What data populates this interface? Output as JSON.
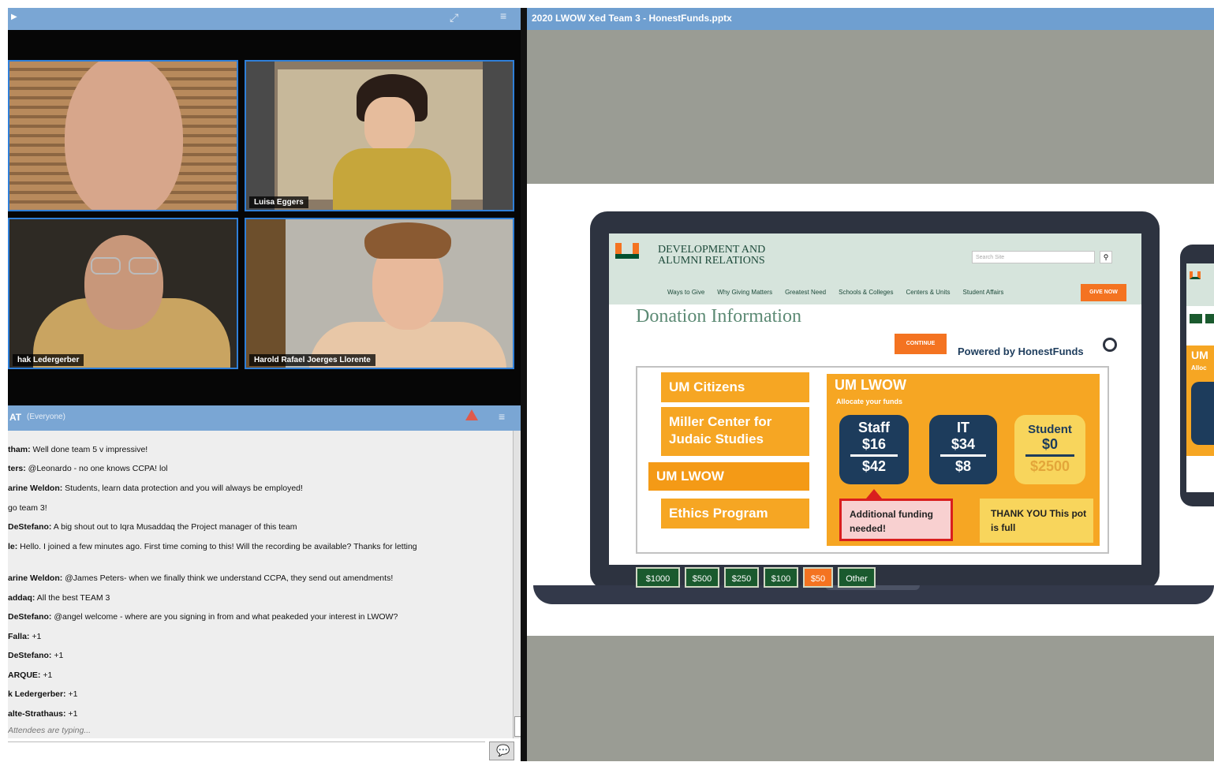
{
  "video": {
    "participants": [
      {
        "name": ""
      },
      {
        "name": "Luisa Eggers"
      },
      {
        "name": "hak Ledergerber"
      },
      {
        "name": "Harold Rafael Joerges Llorente"
      }
    ]
  },
  "chat": {
    "title": "AT",
    "scope": "(Everyone)",
    "messages": [
      {
        "sender": "tham:",
        "text": " Well done team 5 v impressive!"
      },
      {
        "sender": "ters:",
        "text": " @Leonardo - no one knows CCPA! lol"
      },
      {
        "sender": "arine Weldon:",
        "text": " Students, learn data protection and you will always be employed!"
      },
      {
        "sender": "",
        "text": "go team 3!"
      },
      {
        "sender": "DeStefano:",
        "text": " A big shout out to Iqra Musaddaq the Project manager of this team"
      },
      {
        "sender": "le:",
        "text": " Hello. I joined a few minutes ago. First time coming to this! Will the recording be available? Thanks for letting"
      },
      {
        "sender": "arine Weldon:",
        "text": " @James Peters- when we finally think we understand CCPA, they send out amendments!"
      },
      {
        "sender": "addaq:",
        "text": " All the best TEAM 3"
      },
      {
        "sender": "DeStefano:",
        "text": " @angel welcome - where are you signing in from and what peakeded your interest in LWOW?"
      },
      {
        "sender": "Falla:",
        "text": " +1"
      },
      {
        "sender": "DeStefano:",
        "text": " +1"
      },
      {
        "sender": "ARQUE:",
        "text": " +1"
      },
      {
        "sender": "k Ledergerber:",
        "text": " +1"
      },
      {
        "sender": "alte-Strathaus:",
        "text": " +1"
      }
    ],
    "typing": "Attendees are typing..."
  },
  "slide": {
    "title": "2020 LWOW Xed Team 3 - HonestFunds.pptx",
    "site": {
      "org_line1": "DEVELOPMENT AND",
      "org_line2": "ALUMNI RELATIONS",
      "search_placeholder": "Search Site",
      "nav": [
        "Ways to Give",
        "Why Giving Matters",
        "Greatest Need",
        "Schools & Colleges",
        "Centers & Units",
        "Student Affairs"
      ],
      "give_now": "GIVE NOW",
      "heading": "Donation Information",
      "amounts": [
        "$1000",
        "$500",
        "$250",
        "$100",
        "$50",
        "Other"
      ],
      "continue": "CONTINUE",
      "powered": "Powered by HonestFunds",
      "orgs": [
        "UM Citizens",
        "Miller Center for Judaic Studies",
        "UM LWOW",
        "Ethics Program"
      ],
      "panel_title": "UM LWOW",
      "panel_sub": "Allocate your funds",
      "pots": [
        {
          "name": "Staff",
          "amount": "$16",
          "total": "$42"
        },
        {
          "name": "IT",
          "amount": "$34",
          "total": "$8"
        },
        {
          "name": "Student",
          "amount": "$0",
          "total": "$2500"
        }
      ],
      "note_alert": "Additional funding needed!",
      "note_full": "THANK YOU This pot is full",
      "phone_label": "UM",
      "phone_sub": "Alloc"
    }
  },
  "colors": {
    "accent": "#f6a623",
    "header": "#7aa6d4",
    "green": "#1a5a2e",
    "navy": "#1d3c5c"
  }
}
